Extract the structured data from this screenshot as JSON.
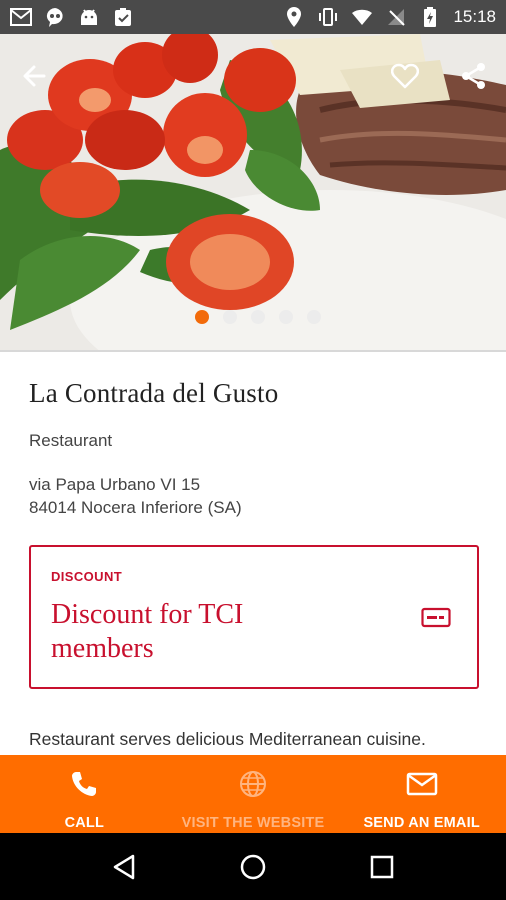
{
  "status_bar": {
    "time": "15:18",
    "icons_left": [
      "gmail-icon",
      "hangouts-icon",
      "android-icon",
      "clipboard-check-icon"
    ],
    "icons_right": [
      "location-icon",
      "vibrate-icon",
      "wifi-icon",
      "no-signal-icon",
      "battery-charging-icon"
    ]
  },
  "hero": {
    "image": "food-photo-tomatoes-arugula-steak",
    "carousel": {
      "count": 5,
      "active_index": 0
    }
  },
  "toolbar": {
    "back_icon": "arrow-back-icon",
    "favorite_icon": "heart-outline-icon",
    "share_icon": "share-icon"
  },
  "place": {
    "name": "La Contrada del Gusto",
    "category": "Restaurant",
    "address_line1": "via Papa Urbano VI 15",
    "address_line2": "84014 Nocera Inferiore (SA)"
  },
  "discount": {
    "label": "DISCOUNT",
    "title": "Discount for TCI members",
    "icon": "membership-card-icon"
  },
  "description": "Restaurant serves delicious Mediterranean cuisine.",
  "actions": [
    {
      "label": "CALL",
      "icon": "phone-icon",
      "enabled": true
    },
    {
      "label": "VISIT THE WEBSITE",
      "icon": "globe-icon",
      "enabled": false
    },
    {
      "label": "SEND AN EMAIL",
      "icon": "mail-icon",
      "enabled": true
    }
  ],
  "colors": {
    "accent": "#ff6d00",
    "discount_red": "#c8102e",
    "active_dot": "#f26a0a"
  }
}
